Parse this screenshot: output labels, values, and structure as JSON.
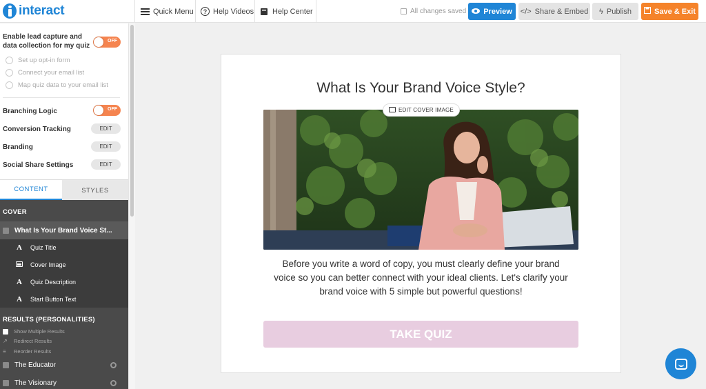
{
  "app": {
    "logo_text": "interact"
  },
  "topbar": {
    "quick_menu": "Quick Menu",
    "help_videos": "Help Videos",
    "help_center": "Help Center",
    "saved_status": "All changes saved",
    "preview": "Preview",
    "share_embed": "Share & Embed",
    "publish": "Publish",
    "save_exit": "Save & Exit"
  },
  "sidebar": {
    "lead_capture_label": "Enable lead capture and data collection for my quiz",
    "lead_capture_toggle": "OFF",
    "lead_options": [
      "Set up opt-in form",
      "Connect your email list",
      "Map quiz data to your email list"
    ],
    "branching_logic": {
      "label": "Branching Logic",
      "toggle": "OFF"
    },
    "settings": [
      {
        "label": "Conversion Tracking",
        "action": "EDIT"
      },
      {
        "label": "Branding",
        "action": "EDIT"
      },
      {
        "label": "Social Share Settings",
        "action": "EDIT"
      }
    ],
    "tabs": {
      "content": "CONTENT",
      "styles": "STYLES"
    },
    "cover_heading": "COVER",
    "cover_item": "What Is Your Brand Voice St...",
    "cover_subitems": [
      {
        "icon": "A",
        "label": "Quiz Title"
      },
      {
        "icon": "image",
        "label": "Cover Image"
      },
      {
        "icon": "A",
        "label": "Quiz Description"
      },
      {
        "icon": "A",
        "label": "Start Button Text"
      }
    ],
    "results_heading": "RESULTS (PERSONALITIES)",
    "results_options": [
      "Show Multiple Results",
      "Redirect Results",
      "Reorder Results"
    ],
    "results": [
      "The Educator",
      "The Visionary"
    ]
  },
  "quiz": {
    "title": "What Is Your Brand Voice Style?",
    "edit_cover": "EDIT COVER IMAGE",
    "description": "Before you write a word of copy, you must clearly define your brand voice so you can better connect with your ideal clients. Let's clarify your brand voice with 5 simple but powerful questions!",
    "button": "TAKE QUIZ"
  },
  "colors": {
    "accent": "#1f85d6",
    "save": "#f5832a",
    "toggle_off": "#f5844f",
    "take_quiz": "#e8cde0"
  }
}
